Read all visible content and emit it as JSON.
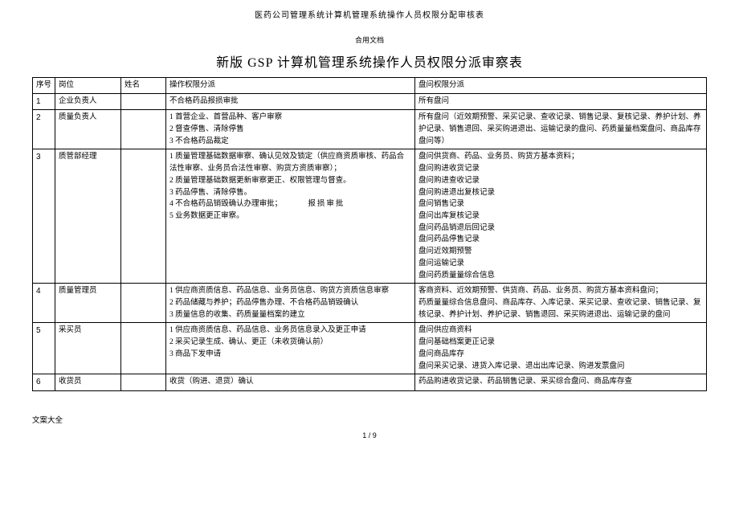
{
  "header": {
    "doc_title": "医药公司管理系统计算机管理系统操作人员权限分配审核表",
    "sub_header": "合用文档",
    "main_title": "新版 GSP 计算机管理系统操作人员权限分派审察表"
  },
  "columns": {
    "seq": "序号",
    "position": "岗位",
    "name": "姓名",
    "op": "操作权限分派",
    "query": "盘问权限分派"
  },
  "rows": [
    {
      "seq": "1",
      "position": "企业负责人",
      "name": "",
      "op": "不合格药品报损审批",
      "query": "所有盘问"
    },
    {
      "seq": "2",
      "position": "质量负责人",
      "name": "",
      "op": "1 首营企业、首营品种、客户审察\n2 督查停售、清除停售\n3 不合格药品裁定",
      "query": "所有盘问（近效期预警、采买记录、查收记录、销售记录、复核记录、养护计划、养护记录、销售退回、采买购进退出、运输记录的盘问、药质量量档案盘问、商品库存盘问等）"
    },
    {
      "seq": "3",
      "position": "质管部经理",
      "name": "",
      "op": "1 质量管理基础数据审察、确认见效及锁定（供应商资质审核、药品合法性审察、业务员合法性审察、购货方资质审察）；\n2 质量管理基础数据更新审察更正、权限管理与督查。\n3 药品停售、清除停售。\n4 不合格药品销毁确认办理审批；　　报损审批\n5 业务数据更正审察。",
      "query": "盘问供货商、药品、业务员、购货方基本资料；\n盘问购进收货记录\n盘问购进查收记录\n盘问购进退出复核记录\n盘问销售记录\n盘问出库复核记录\n盘问药品销退后回记录\n盘问药品停售记录\n盘问近效期预警\n盘问运输记录\n盘问药质量量综合信息"
    },
    {
      "seq": "4",
      "position": "质量管理员",
      "name": "",
      "op": "1 供应商资质信息、药品信息、业务员信息、购货方资质信息审察\n2 药品储藏与养护；药品停售办理、不合格药品销毁确认\n3 质量信息的收集、药质量量档案的建立",
      "query": "客商资料、近效期预警、供货商、药品、业务员、购货方基本资料盘问；\n药质量量综合信息盘问、商品库存、入库记录、采买记录、查收记录、销售记录、复核记录、养护计划、养护记录、销售退回、采买购进退出、运输记录的盘问"
    },
    {
      "seq": "5",
      "position": "采买员",
      "name": "",
      "op": "1 供应商资质信息、药品信息、业务员信息录入及更正申请\n2 采买记录生成、确认、更正（未收货确认前）\n3 商品下发申请",
      "query": "盘问供应商资料\n盘问基础档案更正记录\n盘问商品库存\n盘问采买记录、进货入库记录、退出出库记录、购进发票盘问"
    },
    {
      "seq": "6",
      "position": "收货员",
      "name": "",
      "op": "收货（购进、退货）确认",
      "query": "药品购进收货记录、药品销售记录、采买综合盘问、商品库存查"
    }
  ],
  "footer": {
    "left": "文案大全",
    "page": "1 / 9"
  }
}
